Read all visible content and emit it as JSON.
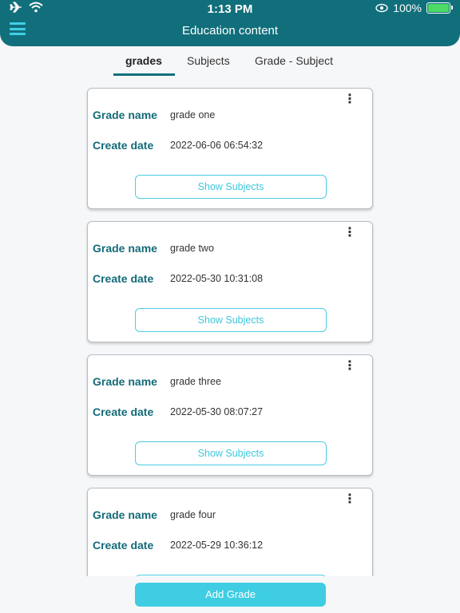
{
  "status": {
    "time": "1:13 PM",
    "battery": "100%"
  },
  "header": {
    "title": "Education content"
  },
  "tabs": [
    {
      "label": "grades"
    },
    {
      "label": "Subjects"
    },
    {
      "label": "Grade - Subject"
    }
  ],
  "labels": {
    "grade_name": "Grade name",
    "create_date": "Create date",
    "show_subjects": "Show Subjects"
  },
  "grades": [
    {
      "name": "grade one",
      "date": "2022-06-06 06:54:32"
    },
    {
      "name": "grade two",
      "date": "2022-05-30 10:31:08"
    },
    {
      "name": "grade three",
      "date": "2022-05-30 08:07:27"
    },
    {
      "name": "grade four",
      "date": "2022-05-29 10:36:12"
    }
  ],
  "footer": {
    "add_label": "Add Grade"
  },
  "icons": {
    "airplane": "airplane-icon",
    "wifi": "wifi-icon",
    "eye": "eye-icon",
    "battery": "battery-icon",
    "menu": "menu-icon",
    "more": "more-vert-icon"
  },
  "colors": {
    "primary": "#116f7c",
    "accent": "#3ecde3"
  }
}
